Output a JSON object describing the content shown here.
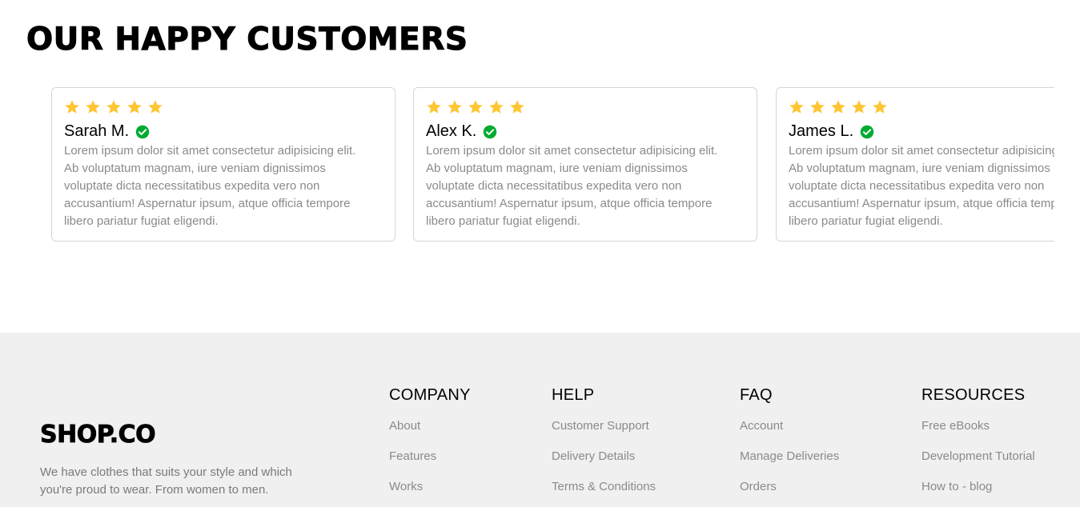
{
  "section": {
    "title": "OUR HAPPY CUSTOMERS"
  },
  "reviews": [
    {
      "name": "Sarah M.",
      "rating": 5,
      "lines": [
        "Lorem ipsum dolor sit amet consectetur adipisicing elit.",
        "Ab voluptatum magnam, iure veniam dignissimos",
        "voluptate dicta necessitatibus expedita vero non",
        "accusantium! Aspernatur ipsum, atque officia tempore",
        "libero pariatur fugiat eligendi."
      ]
    },
    {
      "name": "Alex K.",
      "rating": 5,
      "lines": [
        "Lorem ipsum dolor sit amet consectetur adipisicing elit.",
        "Ab voluptatum magnam, iure veniam dignissimos",
        "voluptate dicta necessitatibus expedita vero non",
        "accusantium! Aspernatur ipsum, atque officia tempore",
        "libero pariatur fugiat eligendi."
      ]
    },
    {
      "name": "James L.",
      "rating": 5,
      "lines": [
        "Lorem ipsum dolor sit amet consectetur adipisicing elit.",
        "Ab voluptatum magnam, iure veniam dignissimos",
        "voluptate dicta necessitatibus expedita vero non",
        "accusantium! Aspernatur ipsum, atque officia tempore",
        "libero pariatur fugiat eligendi."
      ]
    }
  ],
  "footer": {
    "brand": "SHOP.CO",
    "tagline_lines": [
      "We have clothes that suits your style and which",
      "you're proud to wear. From women to men."
    ],
    "columns": [
      {
        "title": "COMPANY",
        "links": [
          "About",
          "Features",
          "Works"
        ]
      },
      {
        "title": "HELP",
        "links": [
          "Customer Support",
          "Delivery Details",
          "Terms & Conditions"
        ]
      },
      {
        "title": "FAQ",
        "links": [
          "Account",
          "Manage Deliveries",
          "Orders"
        ]
      },
      {
        "title": "RESOURCES",
        "links": [
          "Free eBooks",
          "Development Tutorial",
          "How to - blog"
        ]
      }
    ]
  },
  "colors": {
    "star": "#FFC633",
    "verified": "#01AB31",
    "muted_text": "#8a8a8a",
    "footer_bg": "#f0f0f0"
  },
  "icons": {
    "rating": "star-icon",
    "verified": "verified-check-icon"
  }
}
